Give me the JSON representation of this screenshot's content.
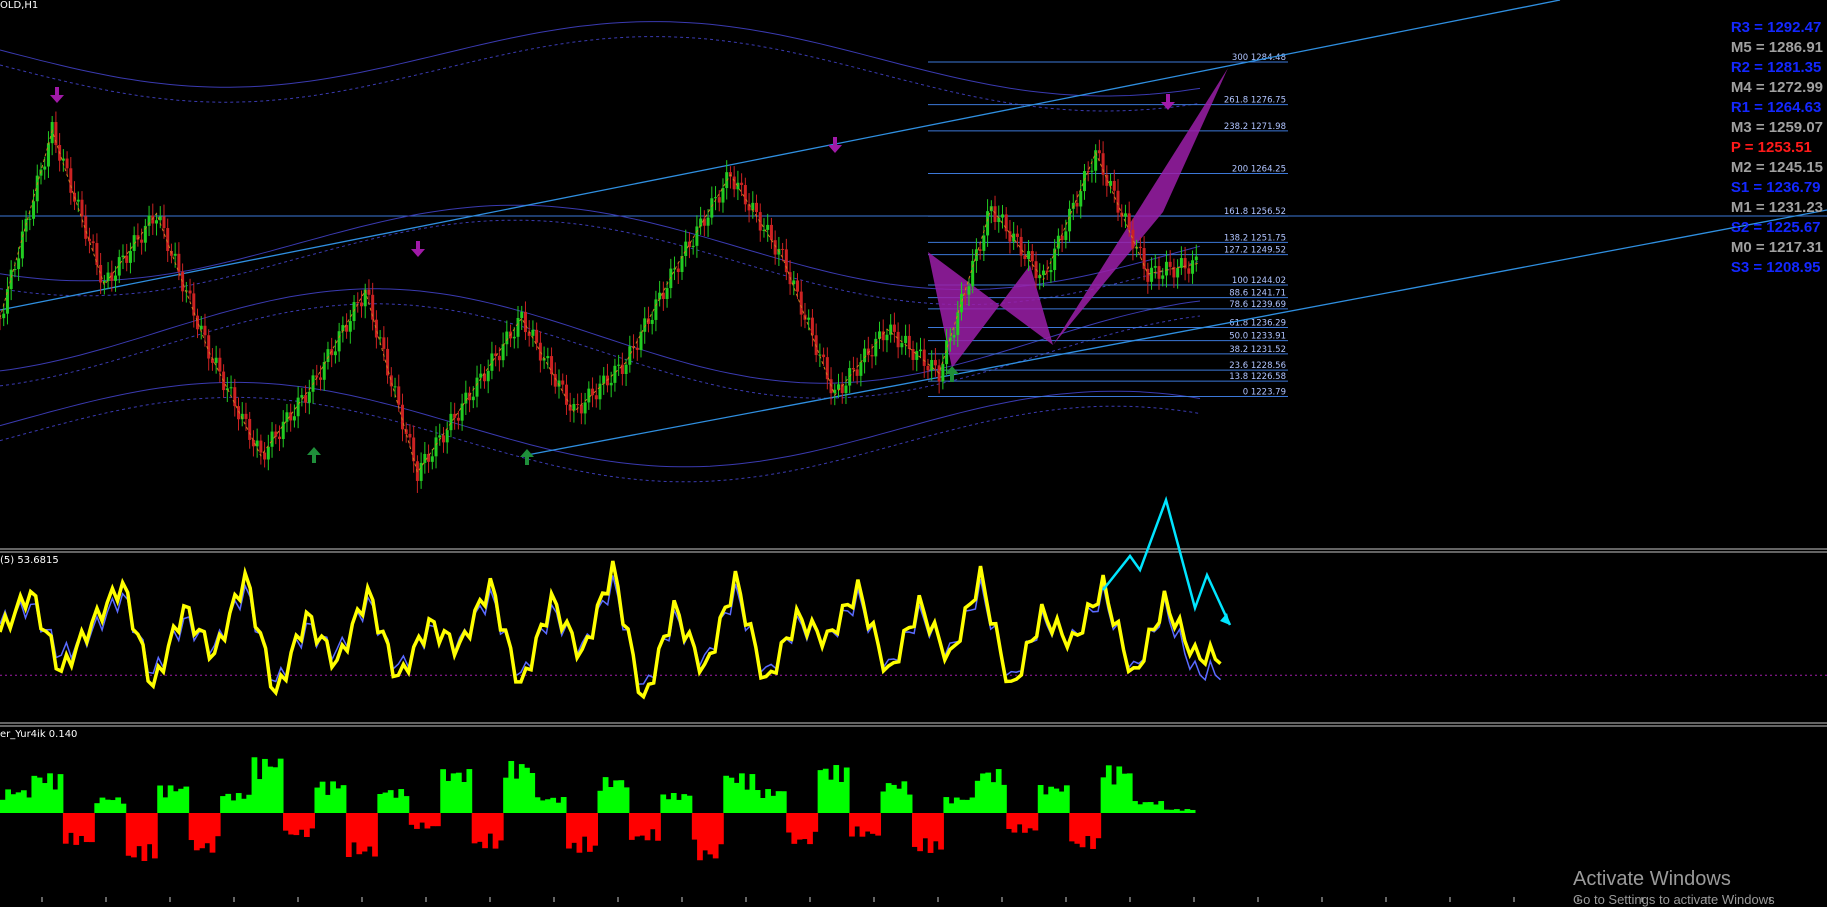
{
  "symbol_label": "OLD,H1",
  "stoch_label": "(5) 53.6815",
  "osc_label": "er_Yur4ik 0.140",
  "watermark": {
    "title": "Activate Windows",
    "subtitle": "Go to Settings to activate Windows"
  },
  "colors": {
    "background": "#000000",
    "pattern_fill": "#9b1fa8",
    "fib_line": "#3c78d8",
    "trend_line": "#2f8fe0",
    "arrow_up": "#1f8f3a",
    "arrow_down": "#a01aa8",
    "stoch_main": "#ffff00",
    "stoch_signal": "#5a6bff",
    "osc_positive": "#00ff00",
    "osc_negative": "#ff0000",
    "forecast_arrow": "#00e5ff"
  },
  "pivot_levels": [
    {
      "label": "R3 = 1292.47",
      "color": "#1428ff"
    },
    {
      "label": "M5 = 1286.91",
      "color": "#a0a0a0"
    },
    {
      "label": "R2 = 1281.35",
      "color": "#1428ff"
    },
    {
      "label": "M4 = 1272.99",
      "color": "#a0a0a0"
    },
    {
      "label": "R1 = 1264.63",
      "color": "#1428ff"
    },
    {
      "label": "M3 = 1259.07",
      "color": "#a0a0a0"
    },
    {
      "label": "P   = 1253.51",
      "color": "#ff1a1a"
    },
    {
      "label": "M2 = 1245.15",
      "color": "#a0a0a0"
    },
    {
      "label": "S1 = 1236.79",
      "color": "#1428ff"
    },
    {
      "label": "M1 = 1231.23",
      "color": "#a0a0a0"
    },
    {
      "label": "S2 = 1225.67",
      "color": "#1428ff"
    },
    {
      "label": "M0 = 1217.31",
      "color": "#a0a0a0"
    },
    {
      "label": "S3 = 1208.95",
      "color": "#1428ff"
    }
  ],
  "chart_data": [
    {
      "type": "line",
      "price_range": [
        1205,
        1295
      ],
      "fib_levels": [
        {
          "label": "300 1284.48",
          "value": 1284.48
        },
        {
          "label": "261.8 1276.75",
          "value": 1276.75
        },
        {
          "label": "238.2 1271.98",
          "value": 1271.98
        },
        {
          "label": "200 1264.25",
          "value": 1264.25
        },
        {
          "label": "161.8 1256.52",
          "value": 1256.52
        },
        {
          "label": "138.2 1251.75",
          "value": 1251.75
        },
        {
          "label": "127.2 1249.52",
          "value": 1249.52
        },
        {
          "label": "100 1244.02",
          "value": 1244.02
        },
        {
          "label": "88.6 1241.71",
          "value": 1241.71
        },
        {
          "label": "78.6 1239.69",
          "value": 1239.69
        },
        {
          "label": "61.8 1236.29",
          "value": 1236.29
        },
        {
          "label": "50.0 1233.91",
          "value": 1233.91
        },
        {
          "label": "38.2 1231.52",
          "value": 1231.52
        },
        {
          "label": "23.6 1228.56",
          "value": 1228.56
        },
        {
          "label": "13.8 1226.58",
          "value": 1226.58
        },
        {
          "label": "0 1223.79",
          "value": 1223.79
        }
      ],
      "zigzag_close": [
        1238,
        1272,
        1244,
        1257,
        1232,
        1213,
        1226,
        1243,
        1210,
        1224,
        1238,
        1221,
        1230,
        1248,
        1264,
        1249,
        1224,
        1236,
        1228,
        1258,
        1245,
        1268,
        1246,
        1248
      ],
      "swing_highs": [
        1272,
        1243,
        1264,
        1268
      ],
      "swing_lows": [
        1213,
        1210,
        1224
      ]
    },
    {
      "type": "line",
      "range": [
        0,
        100
      ],
      "main": [
        55,
        80,
        30,
        60,
        85,
        20,
        70,
        40,
        90,
        15,
        65,
        35,
        80,
        25,
        60,
        45,
        85,
        20,
        75,
        40,
        95,
        10,
        70,
        30,
        88,
        22,
        64,
        50,
        82,
        28,
        72,
        38,
        90,
        18,
        66,
        48,
        84,
        26,
        74,
        40
      ],
      "signal": [
        60,
        72,
        40,
        55,
        78,
        28,
        62,
        45,
        82,
        22,
        58,
        42,
        74,
        32,
        56,
        48,
        78,
        26,
        68,
        44,
        86,
        18,
        64,
        36,
        80,
        28,
        60,
        50,
        76,
        32,
        66,
        42,
        82,
        24,
        62,
        50,
        78,
        30,
        70,
        30
      ]
    },
    {
      "type": "bar",
      "range": [
        -1,
        1
      ],
      "values": [
        0.3,
        0.5,
        -0.4,
        0.2,
        -0.6,
        0.35,
        -0.5,
        0.25,
        0.7,
        -0.3,
        0.4,
        -0.55,
        0.3,
        -0.2,
        0.55,
        -0.45,
        0.65,
        0.2,
        -0.5,
        0.45,
        -0.35,
        0.25,
        -0.6,
        0.5,
        0.3,
        -0.4,
        0.6,
        -0.3,
        0.4,
        -0.5,
        0.2,
        0.55,
        -0.25,
        0.35,
        -0.45,
        0.6,
        0.15,
        0.05
      ]
    }
  ]
}
